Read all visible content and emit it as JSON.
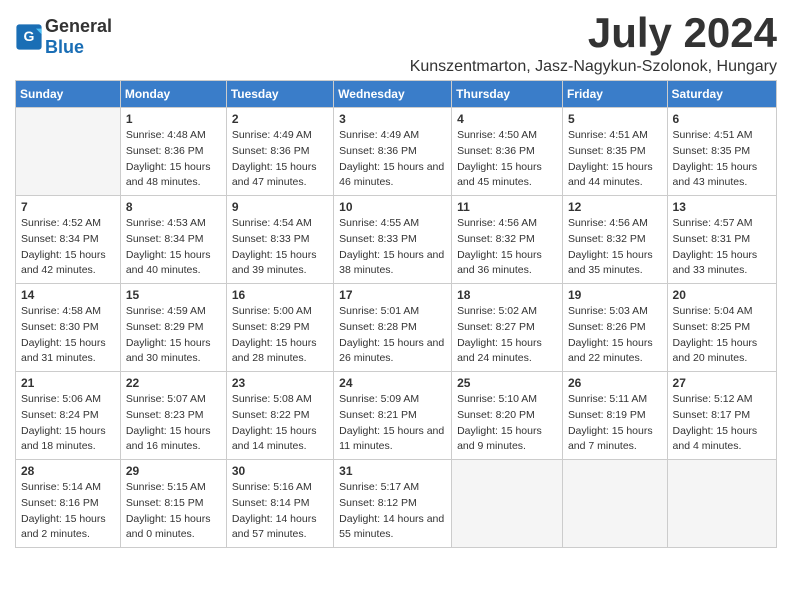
{
  "header": {
    "logo_general": "General",
    "logo_blue": "Blue",
    "month_title": "July 2024",
    "subtitle": "Kunszentmarton, Jasz-Nagykun-Szolonok, Hungary"
  },
  "calendar": {
    "days_of_week": [
      "Sunday",
      "Monday",
      "Tuesday",
      "Wednesday",
      "Thursday",
      "Friday",
      "Saturday"
    ],
    "weeks": [
      {
        "cells": [
          {
            "day": "",
            "empty": true
          },
          {
            "day": "1",
            "sunrise": "Sunrise: 4:48 AM",
            "sunset": "Sunset: 8:36 PM",
            "daylight": "Daylight: 15 hours and 48 minutes."
          },
          {
            "day": "2",
            "sunrise": "Sunrise: 4:49 AM",
            "sunset": "Sunset: 8:36 PM",
            "daylight": "Daylight: 15 hours and 47 minutes."
          },
          {
            "day": "3",
            "sunrise": "Sunrise: 4:49 AM",
            "sunset": "Sunset: 8:36 PM",
            "daylight": "Daylight: 15 hours and 46 minutes."
          },
          {
            "day": "4",
            "sunrise": "Sunrise: 4:50 AM",
            "sunset": "Sunset: 8:36 PM",
            "daylight": "Daylight: 15 hours and 45 minutes."
          },
          {
            "day": "5",
            "sunrise": "Sunrise: 4:51 AM",
            "sunset": "Sunset: 8:35 PM",
            "daylight": "Daylight: 15 hours and 44 minutes."
          },
          {
            "day": "6",
            "sunrise": "Sunrise: 4:51 AM",
            "sunset": "Sunset: 8:35 PM",
            "daylight": "Daylight: 15 hours and 43 minutes."
          }
        ]
      },
      {
        "cells": [
          {
            "day": "7",
            "sunrise": "Sunrise: 4:52 AM",
            "sunset": "Sunset: 8:34 PM",
            "daylight": "Daylight: 15 hours and 42 minutes."
          },
          {
            "day": "8",
            "sunrise": "Sunrise: 4:53 AM",
            "sunset": "Sunset: 8:34 PM",
            "daylight": "Daylight: 15 hours and 40 minutes."
          },
          {
            "day": "9",
            "sunrise": "Sunrise: 4:54 AM",
            "sunset": "Sunset: 8:33 PM",
            "daylight": "Daylight: 15 hours and 39 minutes."
          },
          {
            "day": "10",
            "sunrise": "Sunrise: 4:55 AM",
            "sunset": "Sunset: 8:33 PM",
            "daylight": "Daylight: 15 hours and 38 minutes."
          },
          {
            "day": "11",
            "sunrise": "Sunrise: 4:56 AM",
            "sunset": "Sunset: 8:32 PM",
            "daylight": "Daylight: 15 hours and 36 minutes."
          },
          {
            "day": "12",
            "sunrise": "Sunrise: 4:56 AM",
            "sunset": "Sunset: 8:32 PM",
            "daylight": "Daylight: 15 hours and 35 minutes."
          },
          {
            "day": "13",
            "sunrise": "Sunrise: 4:57 AM",
            "sunset": "Sunset: 8:31 PM",
            "daylight": "Daylight: 15 hours and 33 minutes."
          }
        ]
      },
      {
        "cells": [
          {
            "day": "14",
            "sunrise": "Sunrise: 4:58 AM",
            "sunset": "Sunset: 8:30 PM",
            "daylight": "Daylight: 15 hours and 31 minutes."
          },
          {
            "day": "15",
            "sunrise": "Sunrise: 4:59 AM",
            "sunset": "Sunset: 8:29 PM",
            "daylight": "Daylight: 15 hours and 30 minutes."
          },
          {
            "day": "16",
            "sunrise": "Sunrise: 5:00 AM",
            "sunset": "Sunset: 8:29 PM",
            "daylight": "Daylight: 15 hours and 28 minutes."
          },
          {
            "day": "17",
            "sunrise": "Sunrise: 5:01 AM",
            "sunset": "Sunset: 8:28 PM",
            "daylight": "Daylight: 15 hours and 26 minutes."
          },
          {
            "day": "18",
            "sunrise": "Sunrise: 5:02 AM",
            "sunset": "Sunset: 8:27 PM",
            "daylight": "Daylight: 15 hours and 24 minutes."
          },
          {
            "day": "19",
            "sunrise": "Sunrise: 5:03 AM",
            "sunset": "Sunset: 8:26 PM",
            "daylight": "Daylight: 15 hours and 22 minutes."
          },
          {
            "day": "20",
            "sunrise": "Sunrise: 5:04 AM",
            "sunset": "Sunset: 8:25 PM",
            "daylight": "Daylight: 15 hours and 20 minutes."
          }
        ]
      },
      {
        "cells": [
          {
            "day": "21",
            "sunrise": "Sunrise: 5:06 AM",
            "sunset": "Sunset: 8:24 PM",
            "daylight": "Daylight: 15 hours and 18 minutes."
          },
          {
            "day": "22",
            "sunrise": "Sunrise: 5:07 AM",
            "sunset": "Sunset: 8:23 PM",
            "daylight": "Daylight: 15 hours and 16 minutes."
          },
          {
            "day": "23",
            "sunrise": "Sunrise: 5:08 AM",
            "sunset": "Sunset: 8:22 PM",
            "daylight": "Daylight: 15 hours and 14 minutes."
          },
          {
            "day": "24",
            "sunrise": "Sunrise: 5:09 AM",
            "sunset": "Sunset: 8:21 PM",
            "daylight": "Daylight: 15 hours and 11 minutes."
          },
          {
            "day": "25",
            "sunrise": "Sunrise: 5:10 AM",
            "sunset": "Sunset: 8:20 PM",
            "daylight": "Daylight: 15 hours and 9 minutes."
          },
          {
            "day": "26",
            "sunrise": "Sunrise: 5:11 AM",
            "sunset": "Sunset: 8:19 PM",
            "daylight": "Daylight: 15 hours and 7 minutes."
          },
          {
            "day": "27",
            "sunrise": "Sunrise: 5:12 AM",
            "sunset": "Sunset: 8:17 PM",
            "daylight": "Daylight: 15 hours and 4 minutes."
          }
        ]
      },
      {
        "cells": [
          {
            "day": "28",
            "sunrise": "Sunrise: 5:14 AM",
            "sunset": "Sunset: 8:16 PM",
            "daylight": "Daylight: 15 hours and 2 minutes."
          },
          {
            "day": "29",
            "sunrise": "Sunrise: 5:15 AM",
            "sunset": "Sunset: 8:15 PM",
            "daylight": "Daylight: 15 hours and 0 minutes."
          },
          {
            "day": "30",
            "sunrise": "Sunrise: 5:16 AM",
            "sunset": "Sunset: 8:14 PM",
            "daylight": "Daylight: 14 hours and 57 minutes."
          },
          {
            "day": "31",
            "sunrise": "Sunrise: 5:17 AM",
            "sunset": "Sunset: 8:12 PM",
            "daylight": "Daylight: 14 hours and 55 minutes."
          },
          {
            "day": "",
            "empty": true
          },
          {
            "day": "",
            "empty": true
          },
          {
            "day": "",
            "empty": true
          }
        ]
      }
    ]
  }
}
